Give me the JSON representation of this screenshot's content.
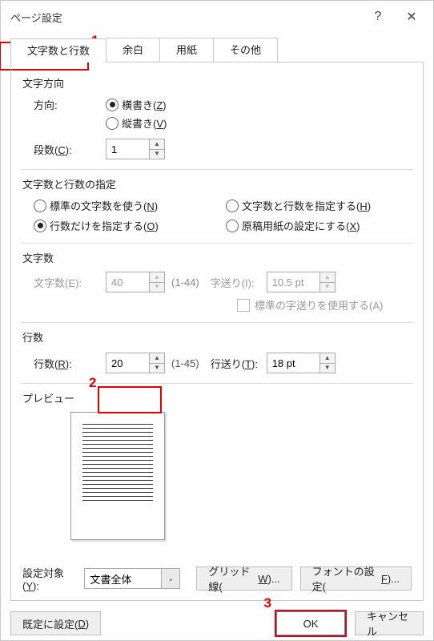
{
  "title": "ページ設定",
  "titlebar": {
    "help_glyph": "?",
    "close_glyph": "✕"
  },
  "tabs": {
    "characters_lines": "文字数と行数",
    "margins": "余白",
    "paper": "用紙",
    "other": "その他"
  },
  "direction": {
    "section": "文字方向",
    "label": "方向:",
    "horizontal": {
      "text": "横書き(",
      "key": "Z",
      "suffix": ")"
    },
    "vertical": {
      "text": "縦書き(",
      "key": "V",
      "suffix": ")"
    }
  },
  "columns": {
    "label_pre": "段数(",
    "label_key": "C",
    "label_post": "):",
    "value": "1"
  },
  "spec": {
    "section": "文字数と行数の指定",
    "standard": {
      "text": "標準の文字数を使う(",
      "key": "N",
      "suffix": ")"
    },
    "both": {
      "text": "文字数と行数を指定する(",
      "key": "H",
      "suffix": ")"
    },
    "lines_only": {
      "text": "行数だけを指定する(",
      "key": "O",
      "suffix": ")"
    },
    "grid_paper": {
      "text": "原稿用紙の設定にする(",
      "key": "X",
      "suffix": ")"
    }
  },
  "chars": {
    "section": "文字数",
    "label": "文字数(E):",
    "value": "40",
    "range": "(1-44)",
    "pitch_label": "字送り(I):",
    "pitch_value": "10.5 pt",
    "use_default_pitch": {
      "text": "標準の字送りを使用する(A)"
    }
  },
  "lines": {
    "section": "行数",
    "label_pre": "行数(",
    "label_key": "R",
    "label_post": "):",
    "value": "20",
    "range": "(1-45)",
    "pitch_label_pre": "行送り(",
    "pitch_label_key": "T",
    "pitch_label_post": "):",
    "pitch_value": "18 pt"
  },
  "preview": {
    "section": "プレビュー"
  },
  "settings_row": {
    "apply_to_label_pre": "設定対象(",
    "apply_to_key": "Y",
    "apply_to_post": "):",
    "apply_to_value": "文書全体",
    "grid_btn_pre": "グリッド線(",
    "grid_btn_key": "W",
    "grid_btn_post": ")...",
    "font_btn_pre": "フォントの設定(",
    "font_btn_key": "F",
    "font_btn_post": ")..."
  },
  "footer": {
    "set_default_pre": "既定に設定(",
    "set_default_key": "D",
    "set_default_post": ")",
    "ok": "OK",
    "cancel": "キャンセル"
  },
  "annotation": {
    "n1": "1",
    "n2": "2",
    "n3": "3"
  },
  "glyph": {
    "up": "▲",
    "down": "▼",
    "drop": "⌄"
  }
}
